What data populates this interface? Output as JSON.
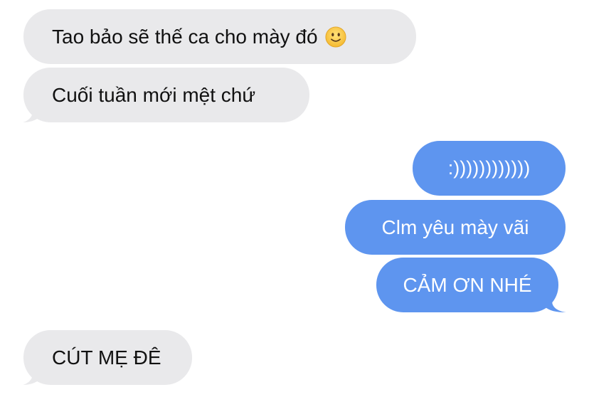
{
  "conversation": {
    "messages": [
      {
        "id": "m1",
        "direction": "incoming",
        "text": "Tao bảo sẽ thế ca cho mày đó",
        "emoji": "slightly-smiling-face-emoji"
      },
      {
        "id": "m2",
        "direction": "incoming",
        "text": "Cuối tuần mới mệt chứ"
      },
      {
        "id": "m3",
        "direction": "outgoing",
        "text": ":))))))))))))"
      },
      {
        "id": "m4",
        "direction": "outgoing",
        "text": "Clm yêu mày vãi"
      },
      {
        "id": "m5",
        "direction": "outgoing",
        "text": "CẢM ƠN NHÉ"
      },
      {
        "id": "m6",
        "direction": "incoming",
        "text": "CÚT MẸ ĐÊ"
      }
    ]
  },
  "colors": {
    "incoming_bubble": "#e9e9eb",
    "incoming_text": "#111111",
    "outgoing_bubble": "#5e95ef",
    "outgoing_text": "#ffffff",
    "background": "#ffffff"
  }
}
